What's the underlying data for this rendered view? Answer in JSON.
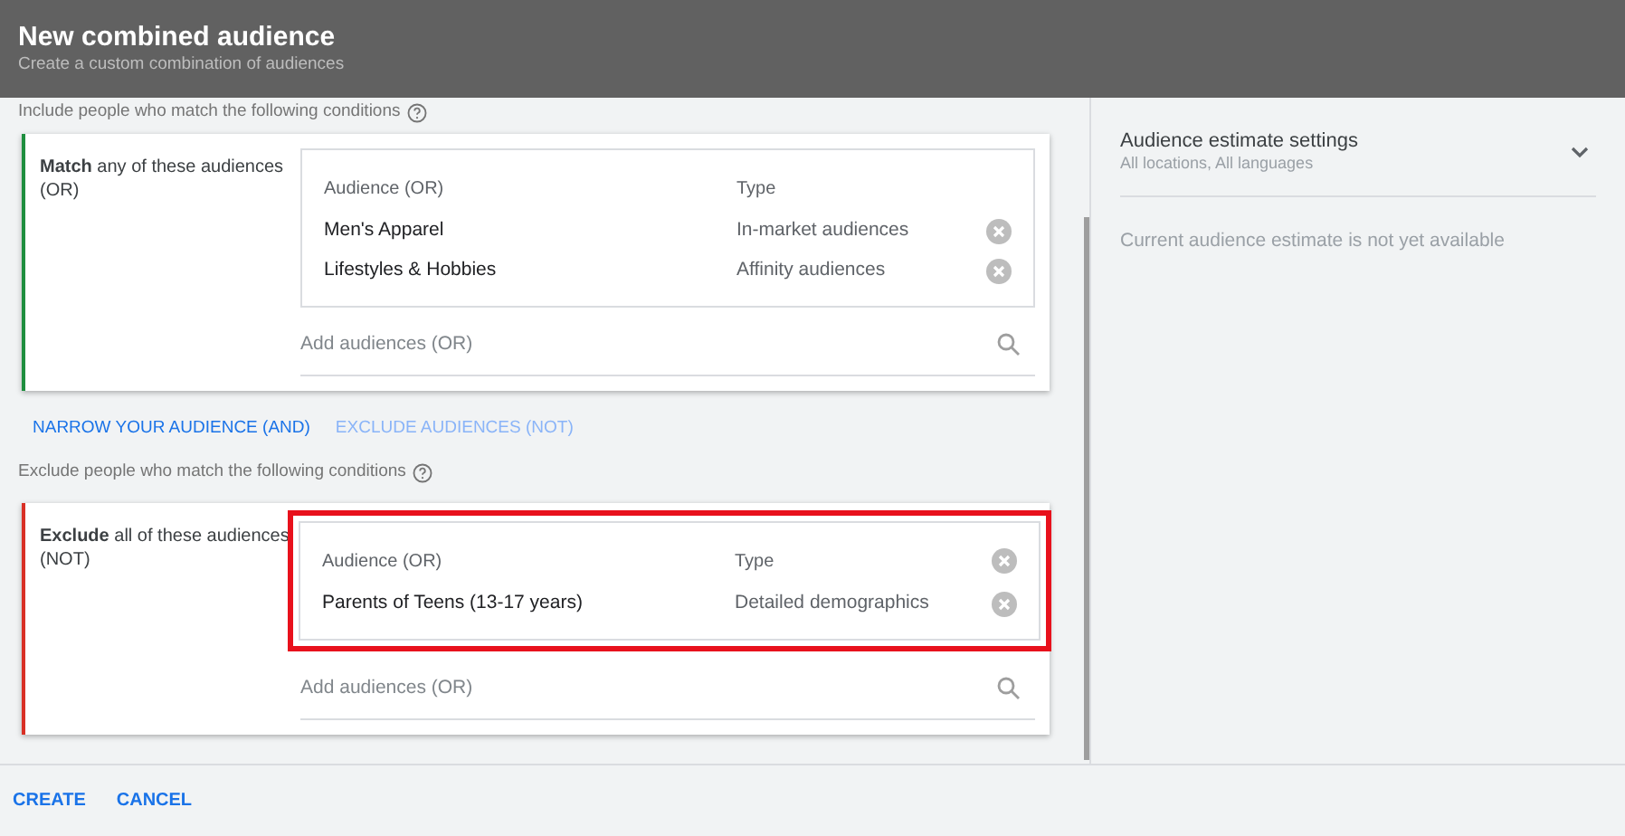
{
  "header": {
    "title": "New combined audience",
    "subtitle": "Create a custom combination of audiences"
  },
  "include_hint": "Include people who match the following conditions",
  "groups": [
    {
      "title": "**Match** any of these audiences (OR)",
      "color": "#1e8e3e",
      "highlighted": false,
      "header_removable": false,
      "columns": [
        "Audience (OR)",
        "Type"
      ],
      "rows": [
        {
          "audience": "Men's Apparel",
          "type": "In-market audiences"
        },
        {
          "audience": "Lifestyles & Hobbies",
          "type": "Affinity audiences"
        }
      ],
      "search": {
        "placeholder": "Add audiences (OR)"
      }
    }
  ],
  "actions": [
    {
      "label": "NARROW YOUR AUDIENCE (AND)",
      "disabled": false
    },
    {
      "label": "EXCLUDE AUDIENCES (NOT)",
      "disabled": true
    }
  ],
  "exclude_hint": "Exclude people who match the following conditions",
  "exclude_groups": [
    {
      "title": "**Exclude** all of these audiences (NOT)",
      "color": "#d93025",
      "highlighted": true,
      "header_removable": true,
      "columns": [
        "Audience (OR)",
        "Type"
      ],
      "rows": [
        {
          "audience": "Parents of Teens (13-17 years)",
          "type": "Detailed demographics"
        }
      ],
      "search": {
        "placeholder": "Add audiences (OR)"
      }
    }
  ],
  "estimate": {
    "title": "Audience estimate settings",
    "subtitle": "All locations, All languages",
    "expanded": false,
    "message": "Current audience estimate is not yet available"
  },
  "footer": [
    "CREATE",
    "CANCEL"
  ]
}
